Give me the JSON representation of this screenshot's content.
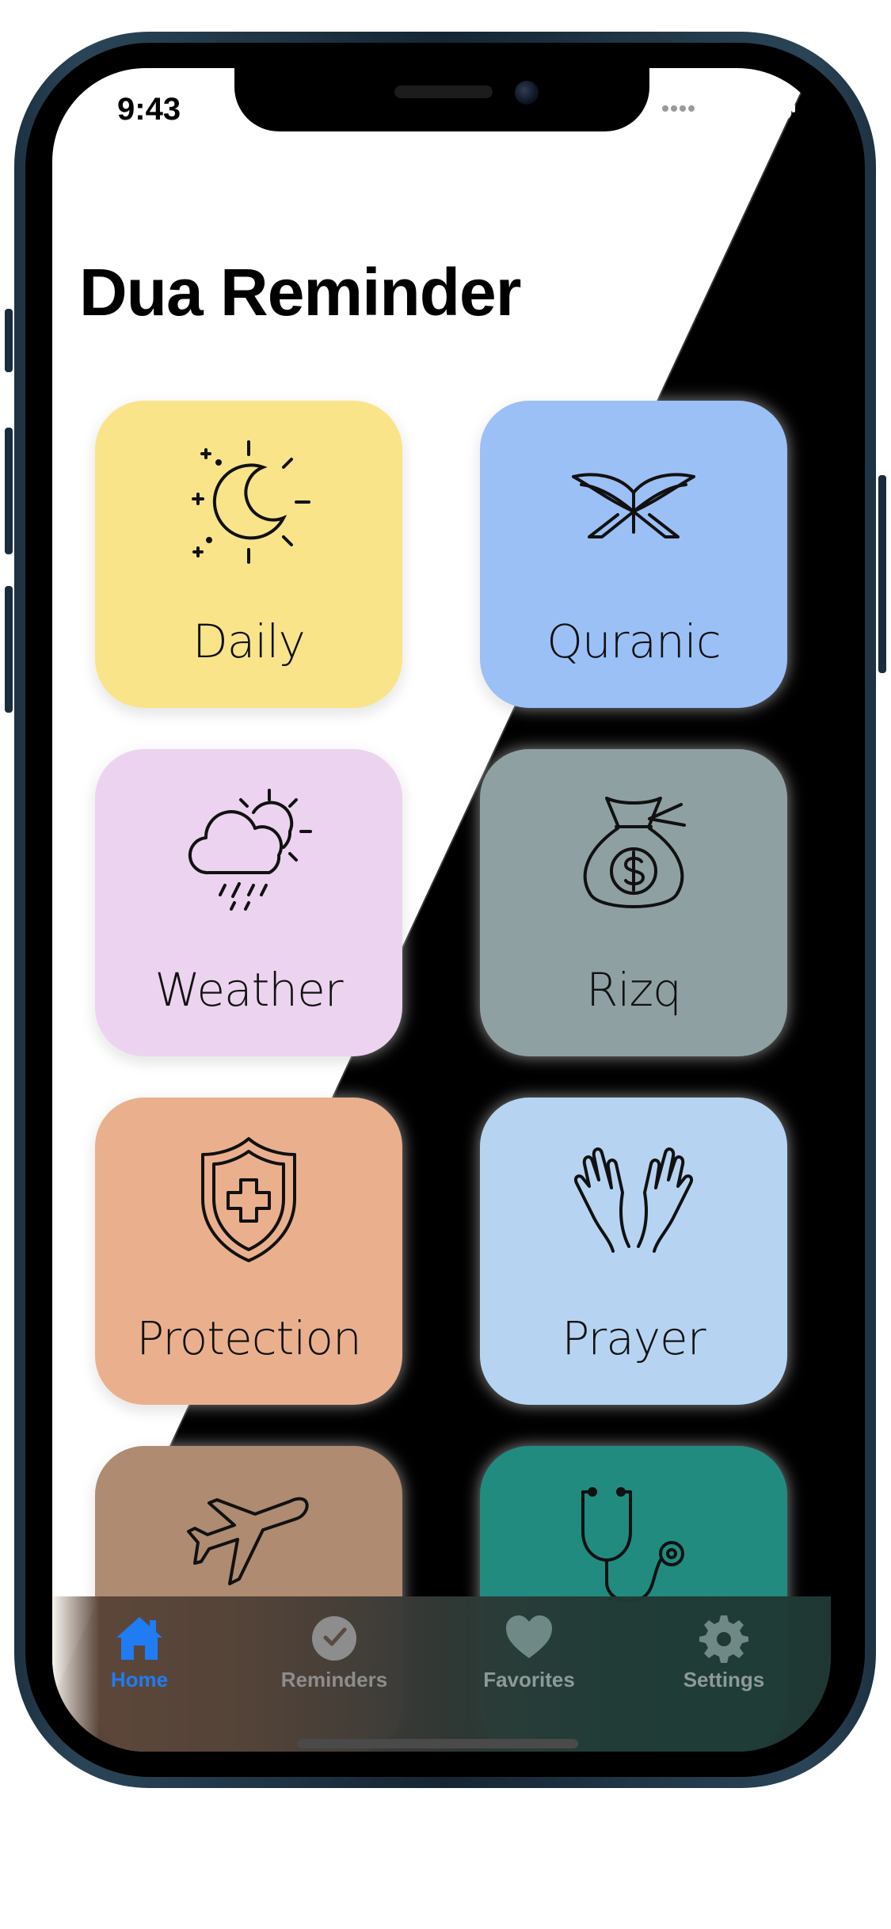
{
  "status_bar": {
    "time": "9:43"
  },
  "header": {
    "title": "Dua Reminder"
  },
  "categories": [
    {
      "label": "Daily",
      "icon": "sun-moon-icon",
      "color": "#f9e489"
    },
    {
      "label": "Quranic",
      "icon": "open-quran-icon",
      "color": "#9bc0f6"
    },
    {
      "label": "Weather",
      "icon": "cloud-rain-sun-icon",
      "color": "#ecd3ef"
    },
    {
      "label": "Rizq",
      "icon": "money-bag-icon",
      "color": "#8fa0a3"
    },
    {
      "label": "Protection",
      "icon": "shield-cross-icon",
      "color": "#eab08d"
    },
    {
      "label": "Prayer",
      "icon": "praying-hands-icon",
      "color": "#b6d4f2"
    },
    {
      "label": "",
      "icon": "airplane-icon",
      "color": "#ae8b71"
    },
    {
      "label": "",
      "icon": "stethoscope-icon",
      "color": "#218b80"
    }
  ],
  "tab_bar": {
    "items": [
      {
        "label": "Home",
        "icon": "house-icon",
        "color": "#1f7cf2",
        "active": true
      },
      {
        "label": "Reminders",
        "icon": "clock-icon",
        "color": "#8d8d8d",
        "active": false
      },
      {
        "label": "Favorites",
        "icon": "heart-icon",
        "color": "#8d8d8d",
        "active": false
      },
      {
        "label": "Settings",
        "icon": "gear-icon",
        "color": "#8d8d8d",
        "active": false
      }
    ]
  }
}
